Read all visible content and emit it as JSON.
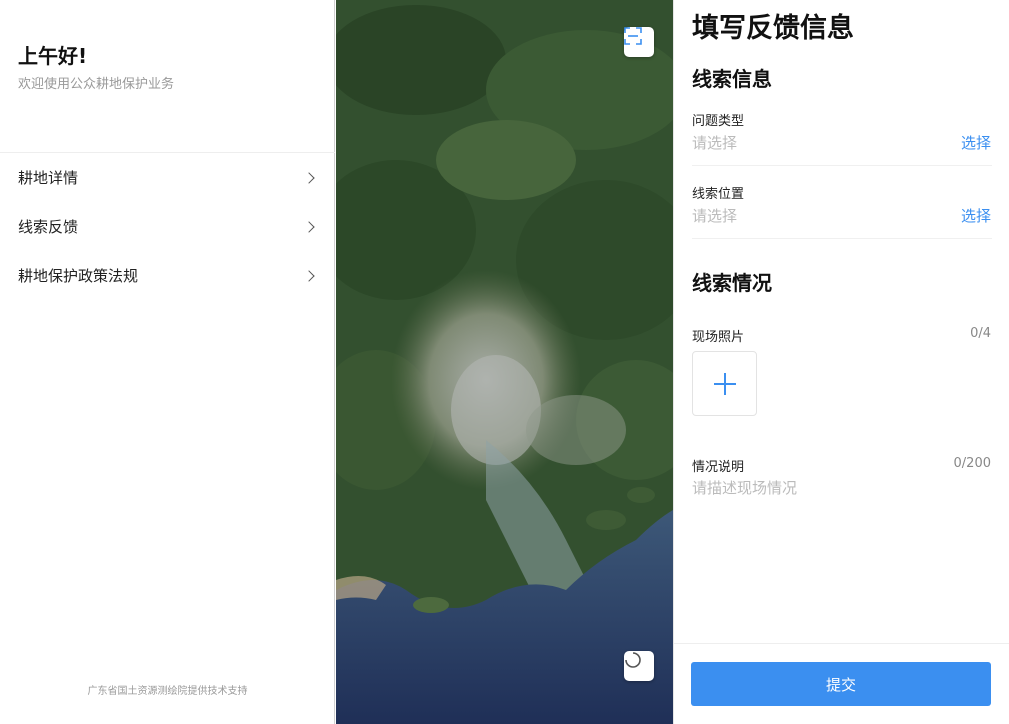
{
  "sidebar": {
    "greeting": "上午好!",
    "welcome": "欢迎使用公众耕地保护业务",
    "items": [
      {
        "label": "耕地详情"
      },
      {
        "label": "线索反馈"
      },
      {
        "label": "耕地保护政策法规"
      }
    ],
    "footer": "广东省国土资源测绘院提供技术支持"
  },
  "map": {
    "top_button_icon": "scan-icon",
    "bottom_button_icon": "loading-icon"
  },
  "form": {
    "title": "填写反馈信息",
    "clue_info_title": "线索信息",
    "problem_type": {
      "label": "问题类型",
      "placeholder": "请选择",
      "action": "选择"
    },
    "clue_location": {
      "label": "线索位置",
      "placeholder": "请选择",
      "action": "选择"
    },
    "clue_situation_title": "线索情况",
    "photos": {
      "label": "现场照片",
      "count": "0/4"
    },
    "description": {
      "label": "情况说明",
      "count": "0/200",
      "placeholder": "请描述现场情况"
    },
    "submit_label": "提交"
  },
  "colors": {
    "accent": "#3b8ff0"
  }
}
